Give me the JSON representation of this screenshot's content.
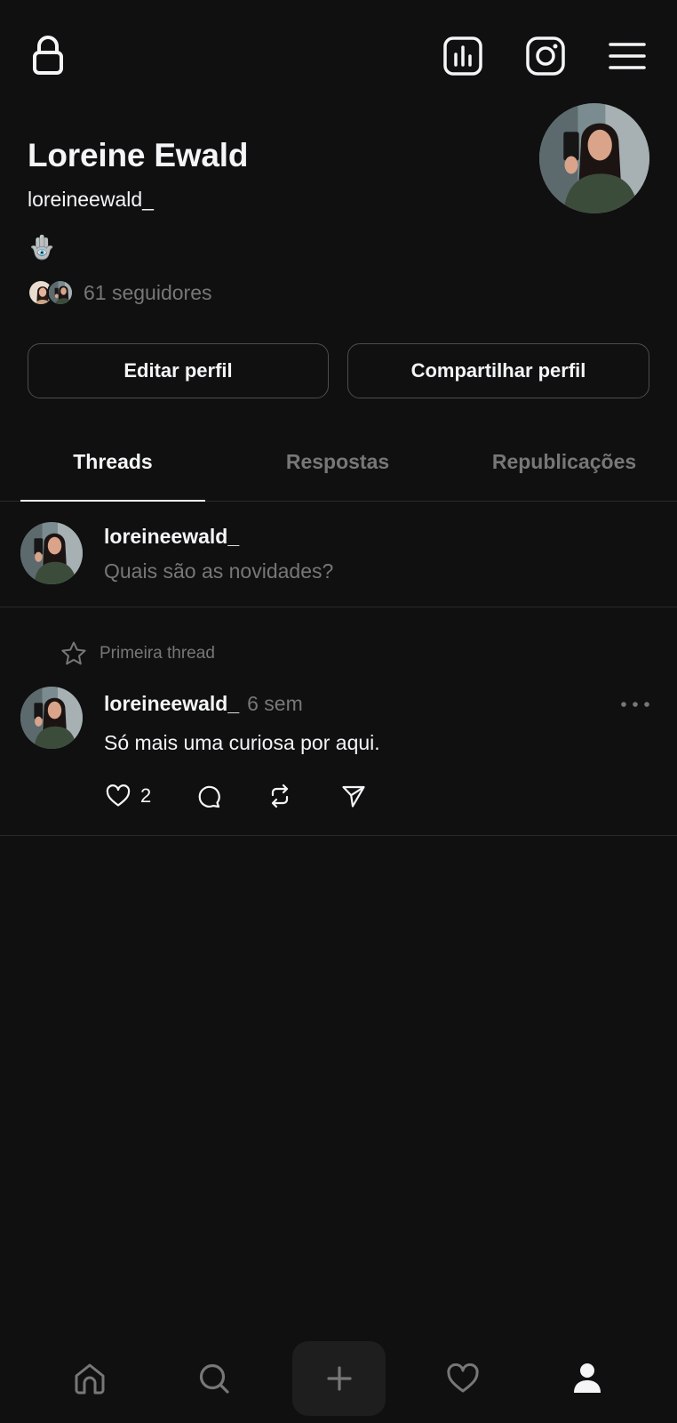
{
  "profile": {
    "name": "Loreine Ewald",
    "handle": "loreineewald_",
    "bio": "🪬",
    "followers_text": "61 seguidores"
  },
  "top_icons": [
    "lock-icon",
    "insights-icon",
    "instagram-icon",
    "menu-icon"
  ],
  "buttons": {
    "edit": "Editar perfil",
    "share": "Compartilhar perfil"
  },
  "tabs": [
    {
      "label": "Threads",
      "active": true
    },
    {
      "label": "Respostas",
      "active": false
    },
    {
      "label": "Republicações",
      "active": false
    }
  ],
  "composer": {
    "username": "loreineewald_",
    "placeholder": "Quais são as novidades?"
  },
  "post": {
    "pinned_label": "Primeira thread",
    "username": "loreineewald_",
    "time": "6 sem",
    "text": "Só mais uma curiosa por aqui.",
    "likes": "2"
  },
  "bottom_nav": [
    "home-icon",
    "search-icon",
    "plus-icon",
    "heart-icon",
    "profile-icon"
  ],
  "colors": {
    "background": "#101010",
    "text_primary": "#f3f5f7",
    "text_secondary": "#777777",
    "border": "#4d4d4d",
    "divider": "#2a2a2a"
  }
}
